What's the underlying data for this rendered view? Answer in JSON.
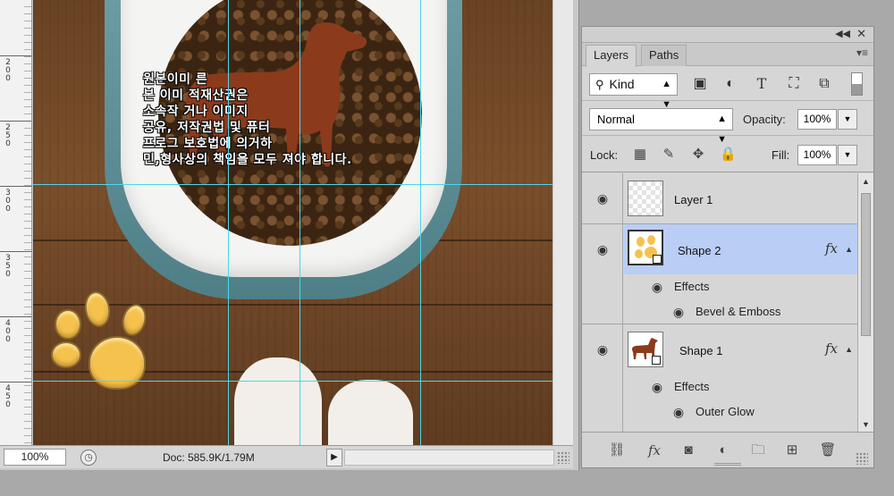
{
  "document": {
    "ruler_labels": [
      "2\n0\n0",
      "2\n5\n0",
      "3\n0\n0",
      "3\n5\n0",
      "4\n0\n0",
      "4\n5\n0"
    ],
    "korean_text": [
      "원본이미                        른",
      "본 이미                    적재산권은",
      "소속작                         거나 이미지",
      "공유,   저작권법 및      퓨터",
      "프로그   보호법에 의거하",
      "민,형사상의 책임을 모두 져야 합니다."
    ],
    "status": {
      "zoom": "100%",
      "doc_info": "Doc: 585.9K/1.79M"
    }
  },
  "layers_panel": {
    "tabs": [
      {
        "label": "Layers",
        "active": true
      },
      {
        "label": "Paths",
        "active": false
      }
    ],
    "filter": {
      "kind_label": "Kind"
    },
    "blend_mode": "Normal",
    "opacity_label": "Opacity:",
    "opacity_value": "100%",
    "lock_label": "Lock:",
    "fill_label": "Fill:",
    "fill_value": "100%",
    "layers": [
      {
        "name": "Layer 1",
        "selected": false,
        "has_fx": false
      },
      {
        "name": "Shape 2",
        "selected": true,
        "has_fx": true,
        "fx_label": "fx",
        "effects_label": "Effects",
        "effect": "Bevel & Emboss"
      },
      {
        "name": "Shape 1",
        "selected": false,
        "has_fx": true,
        "fx_label": "fx",
        "effects_label": "Effects",
        "effect": "Outer Glow"
      }
    ]
  },
  "colors": {
    "selection": "#b9cdf5",
    "guide": "#4fd6e8",
    "dog_shape": "#8c3a1c",
    "paw_shape": "#f6c24e"
  }
}
